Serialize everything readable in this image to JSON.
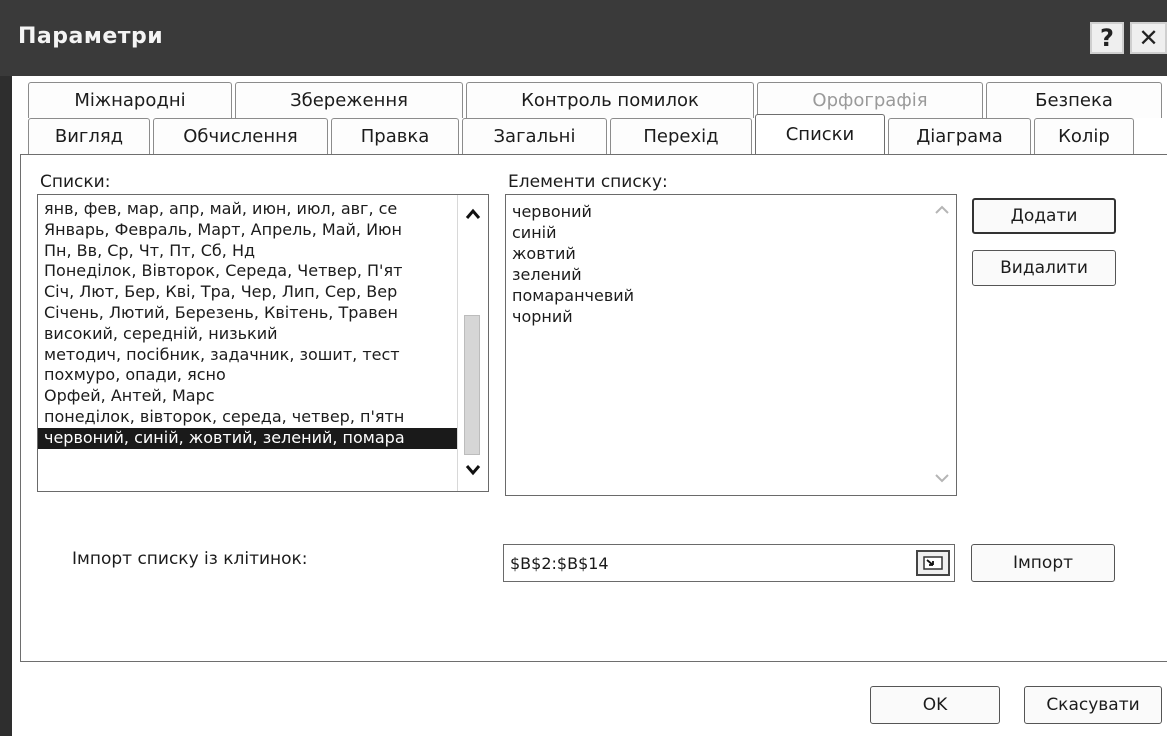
{
  "window": {
    "title": "Параметри",
    "help_label": "?",
    "close_label": "✕"
  },
  "tabs": {
    "row1": [
      "Міжнародні",
      "Збереження",
      "Контроль помилок",
      "Орфографія",
      "Безпека"
    ],
    "row2": [
      "Вигляд",
      "Обчислення",
      "Правка",
      "Загальні",
      "Перехід",
      "Списки",
      "Діаграма",
      "Колір"
    ],
    "active": "Списки",
    "disabled": "Орфографія"
  },
  "lists": {
    "label": "Списки:",
    "items": [
      "янв, фев, мар, апр, май, июн, июл, авг, се",
      "Январь, Февраль, Март, Апрель, Май, Июн",
      "Пн, Вв, Ср, Чт, Пт, Сб, Нд",
      "Понеділок, Вівторок, Середа, Четвер, П'ят",
      "Січ, Лют, Бер, Кві, Тра, Чер, Лип, Сер, Вер",
      "Січень, Лютий, Березень, Квітень, Травен",
      "високий, середній, низький",
      "методич, посібник, задачник, зошит, тест",
      "похмуро, опади, ясно",
      "Орфей, Антей, Марс",
      "понеділок, вівторок, середа, четвер, п'ятн",
      "червоний, синій, жовтий, зелений, помара"
    ],
    "selected_index": 11
  },
  "elements": {
    "label": "Елементи списку:",
    "items": [
      "червоний",
      "синій",
      "жовтий",
      "зелений",
      "помаранчевий",
      "чорний"
    ]
  },
  "buttons": {
    "add": "Додати",
    "delete": "Видалити",
    "import": "Імпорт",
    "ok": "OK",
    "cancel": "Скасувати"
  },
  "import": {
    "label": "Імпорт списку із клітинок:",
    "value": "$B$2:$B$14"
  },
  "icons": {
    "scroll_up": "chevron-up-icon",
    "scroll_down": "chevron-down-icon",
    "range_select": "range-select-icon"
  }
}
